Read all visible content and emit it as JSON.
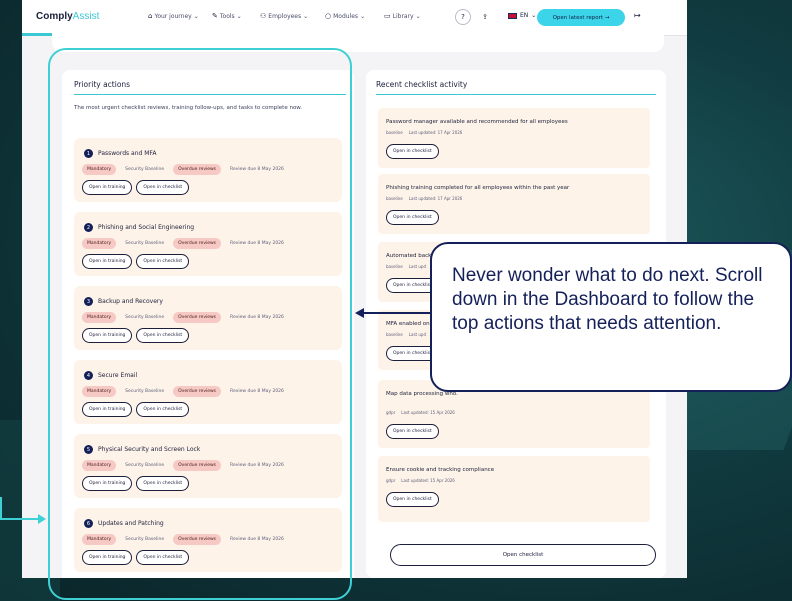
{
  "app": {
    "logo_main": "Comply",
    "logo_accent": "Assist",
    "nav": [
      "Your journey",
      "Tools",
      "Employees",
      "Modules",
      "Library"
    ],
    "help_label": "?",
    "lang_label": "EN",
    "report_button": "Open latest report →"
  },
  "priority": {
    "title": "Priority actions",
    "description": "The most urgent checklist reviews, training follow-ups, and tasks to complete now.",
    "items": [
      {
        "num": "1",
        "title": "Passwords and MFA",
        "tags": [
          "Mandatory",
          "Security Baseline",
          "Overdue reviews",
          "Review due 8 May 2026"
        ],
        "buttons": [
          "Open in training",
          "Open in checklist"
        ]
      },
      {
        "num": "2",
        "title": "Phishing and Social Engineering",
        "tags": [
          "Mandatory",
          "Security Baseline",
          "Overdue reviews",
          "Review due 8 May 2026"
        ],
        "buttons": [
          "Open in training",
          "Open in checklist"
        ]
      },
      {
        "num": "3",
        "title": "Backup and Recovery",
        "tags": [
          "Mandatory",
          "Security Baseline",
          "Overdue reviews",
          "Review due 8 May 2026"
        ],
        "buttons": [
          "Open in training",
          "Open in checklist"
        ]
      },
      {
        "num": "4",
        "title": "Secure Email",
        "tags": [
          "Mandatory",
          "Security Baseline",
          "Overdue reviews",
          "Review due 8 May 2026"
        ],
        "buttons": [
          "Open in training",
          "Open in checklist"
        ]
      },
      {
        "num": "5",
        "title": "Physical Security and Screen Lock",
        "tags": [
          "Mandatory",
          "Security Baseline",
          "Overdue reviews",
          "Review due 8 May 2026"
        ],
        "buttons": [
          "Open in training",
          "Open in checklist"
        ]
      },
      {
        "num": "6",
        "title": "Updates and Patching",
        "tags": [
          "Mandatory",
          "Security Baseline",
          "Overdue reviews",
          "Review due 8 May 2026"
        ],
        "buttons": [
          "Open in training",
          "Open in checklist"
        ]
      }
    ]
  },
  "recent": {
    "title": "Recent checklist activity",
    "items": [
      {
        "title": "Password manager available and recommended for all employees",
        "tag": "baseline",
        "updated": "Last updated: 17 Apr 2026",
        "button": "Open in checklist"
      },
      {
        "title": "Phishing training completed for all employees within the past year",
        "tag": "baseline",
        "updated": "Last updated: 17 Apr 2026",
        "button": "Open in checklist"
      },
      {
        "title": "Automated backu",
        "tag": "baseline",
        "updated": "Last upd",
        "button": "Open in checklist"
      },
      {
        "title": "MFA enabled on",
        "tag": "baseline",
        "updated": "Last upd",
        "button": "Open in checklist"
      },
      {
        "title": "Map data processing who.",
        "tag": "gdpr",
        "updated": "Last updated: 15 Apr 2026",
        "button": "Open in checklist"
      },
      {
        "title": "Ensure cookie and tracking compliance",
        "tag": "gdpr",
        "updated": "Last updated: 15 Apr 2026",
        "button": "Open in checklist"
      }
    ],
    "open_checklist": "Open checklist"
  },
  "callout": {
    "text": "Never wonder what to do next. Scroll down in the Dashboard to follow the top actions that needs attention."
  },
  "colors": {
    "accent": "#3cc7d4",
    "navy": "#14205a",
    "badge_red": "#f6c9c4",
    "item_bg": "#fdf3e8"
  }
}
